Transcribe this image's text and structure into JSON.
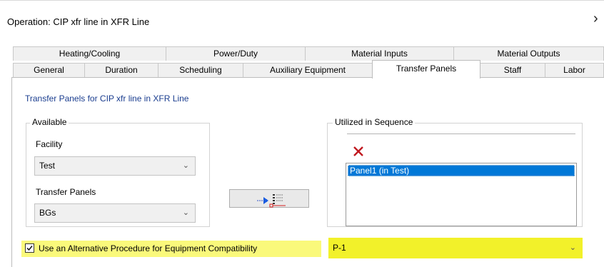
{
  "window": {
    "title": "Operation: CIP xfr line in XFR Line",
    "close_glyph": "›"
  },
  "tabs": {
    "row1": [
      "Heating/Cooling",
      "Power/Duty",
      "Material Inputs",
      "Material Outputs"
    ],
    "row2": [
      "General",
      "Duration",
      "Scheduling",
      "Auxiliary Equipment",
      "Transfer Panels",
      "Staff",
      "Labor"
    ],
    "active": "Transfer Panels"
  },
  "panel": {
    "heading": "Transfer Panels for CIP xfr line in XFR Line",
    "available": {
      "group_label": "Available",
      "facility_label": "Facility",
      "facility_value": "Test",
      "transfer_panels_label": "Transfer Panels",
      "transfer_panels_value": "BGs"
    },
    "utilized": {
      "group_label": "Utilized in Sequence",
      "items": [
        "Panel1 (in Test)"
      ],
      "selected_index": 0
    },
    "alt_procedure": {
      "checked": true,
      "checkbox_label": "Use an Alternative Procedure for Equipment Compatibility",
      "procedure_value": "P-1"
    }
  },
  "colors": {
    "accent": "#0078d7",
    "heading": "#1a3d8f",
    "highlight": "#faf97b",
    "delete_icon": "#c0181f"
  }
}
